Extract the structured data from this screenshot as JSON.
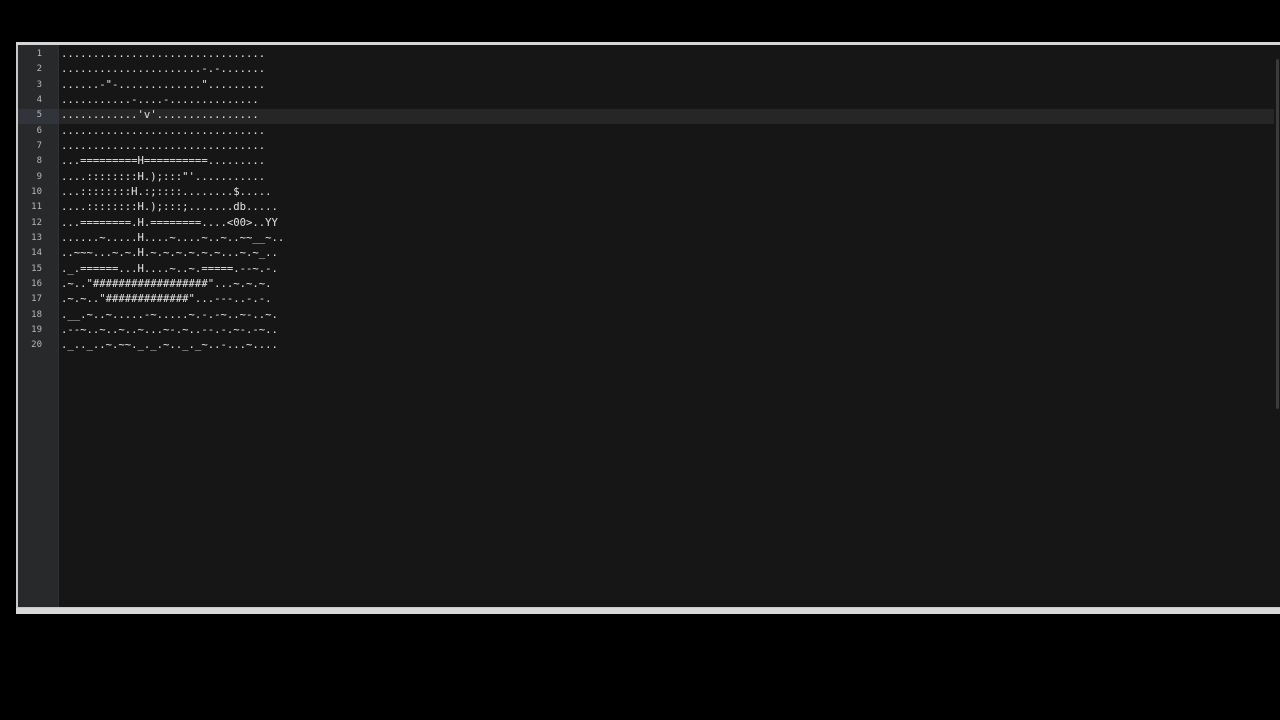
{
  "editor": {
    "current_line": 5,
    "line_numbers": [
      "1",
      "2",
      "3",
      "4",
      "5",
      "6",
      "7",
      "8",
      "9",
      "10",
      "11",
      "12",
      "13",
      "14",
      "15",
      "16",
      "17",
      "18",
      "19",
      "20"
    ],
    "lines": [
      "................................",
      "......................-.-.......",
      "......-\"-.............\".........",
      "...........-....-..............",
      "............'v'................",
      "................................",
      "................................",
      "...=========H==========.........",
      "....::::::::H.);:::\"'...........",
      "...::::::::H.:;::::........$.....",
      "....::::::::H.);:::;.......db.....",
      "...========.H.========....<00>..YY",
      "......~.....H....~....~..~..~~__~..",
      "..~~~...~.~.H.~.~.~.~.~.~...~.~_..",
      "._.======...H....~..~.=====.--~.-.",
      ".~..\"##################\"...~.~.~.",
      ".~.~..\"#############\"...---..-.-.",
      ".__.~..~.....-~.....~.-.-~..~-..~.",
      ".--~..~..~..~...~-.~..--.-.~-.-~..",
      "._.._..~.~~._._.~.._._~..-...~...."
    ]
  }
}
